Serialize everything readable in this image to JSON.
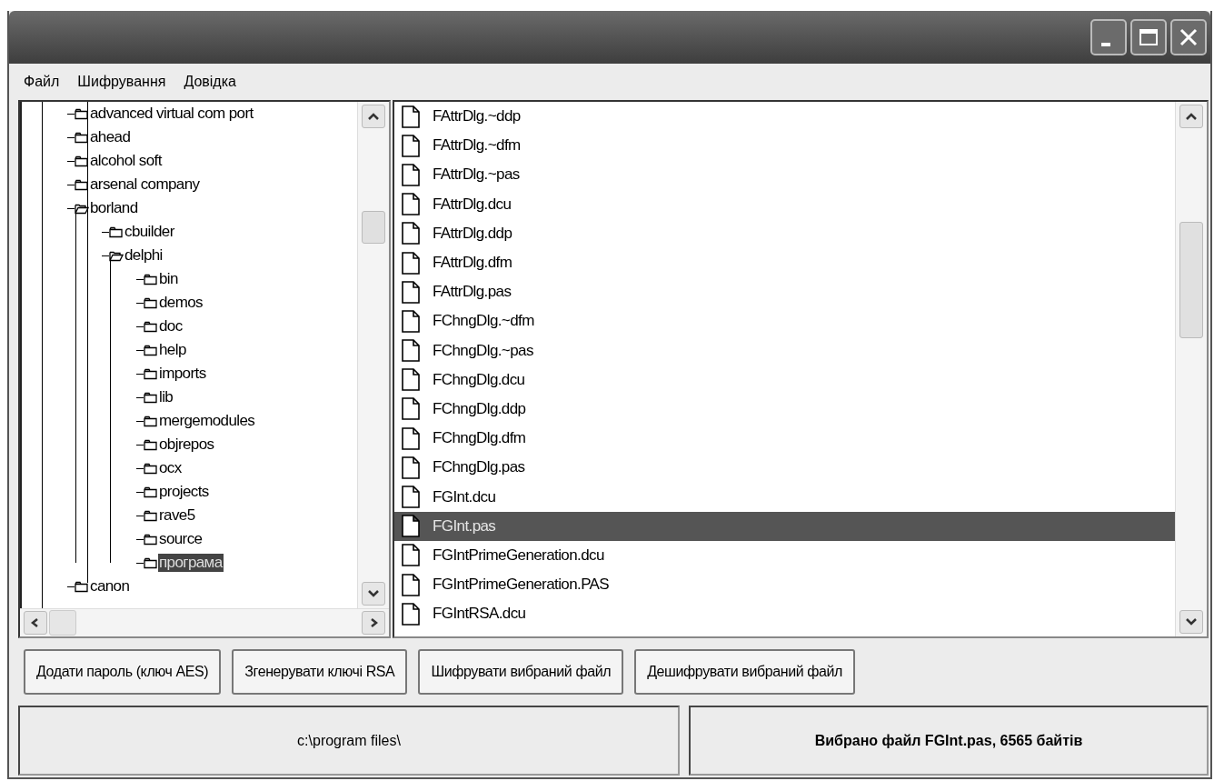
{
  "menu": [
    {
      "label": "Файл"
    },
    {
      "label": "Шифрування"
    },
    {
      "label": "Довідка"
    }
  ],
  "tree": [
    {
      "label": "advanced virtual com port",
      "expanded": false,
      "selected": false
    },
    {
      "label": "ahead",
      "expanded": false,
      "selected": false
    },
    {
      "label": "alcohol soft",
      "expanded": false,
      "selected": false
    },
    {
      "label": "arsenal company",
      "expanded": false,
      "selected": false
    },
    {
      "label": "borland",
      "expanded": true,
      "selected": false,
      "children": [
        {
          "label": "cbuilder",
          "expanded": false,
          "selected": false
        },
        {
          "label": "delphi",
          "expanded": true,
          "selected": false,
          "children": [
            {
              "label": "bin",
              "expanded": false,
              "selected": false
            },
            {
              "label": "demos",
              "expanded": false,
              "selected": false
            },
            {
              "label": "doc",
              "expanded": false,
              "selected": false
            },
            {
              "label": "help",
              "expanded": false,
              "selected": false
            },
            {
              "label": "imports",
              "expanded": false,
              "selected": false
            },
            {
              "label": "lib",
              "expanded": false,
              "selected": false
            },
            {
              "label": "mergemodules",
              "expanded": false,
              "selected": false
            },
            {
              "label": "objrepos",
              "expanded": false,
              "selected": false
            },
            {
              "label": "ocx",
              "expanded": false,
              "selected": false
            },
            {
              "label": "projects",
              "expanded": false,
              "selected": false
            },
            {
              "label": "rave5",
              "expanded": false,
              "selected": false
            },
            {
              "label": "source",
              "expanded": false,
              "selected": false
            },
            {
              "label": "програма",
              "expanded": false,
              "selected": true
            }
          ]
        }
      ]
    },
    {
      "label": "canon",
      "expanded": false,
      "selected": false
    }
  ],
  "files": [
    {
      "name": "FAttrDlg.~ddp",
      "selected": false
    },
    {
      "name": "FAttrDlg.~dfm",
      "selected": false
    },
    {
      "name": "FAttrDlg.~pas",
      "selected": false
    },
    {
      "name": "FAttrDlg.dcu",
      "selected": false
    },
    {
      "name": "FAttrDlg.ddp",
      "selected": false
    },
    {
      "name": "FAttrDlg.dfm",
      "selected": false
    },
    {
      "name": "FAttrDlg.pas",
      "selected": false
    },
    {
      "name": "FChngDlg.~dfm",
      "selected": false
    },
    {
      "name": "FChngDlg.~pas",
      "selected": false
    },
    {
      "name": "FChngDlg.dcu",
      "selected": false
    },
    {
      "name": "FChngDlg.ddp",
      "selected": false
    },
    {
      "name": "FChngDlg.dfm",
      "selected": false
    },
    {
      "name": "FChngDlg.pas",
      "selected": false
    },
    {
      "name": "FGInt.dcu",
      "selected": false
    },
    {
      "name": "FGInt.pas",
      "selected": true
    },
    {
      "name": "FGIntPrimeGeneration.dcu",
      "selected": false
    },
    {
      "name": "FGIntPrimeGeneration.PAS",
      "selected": false
    },
    {
      "name": "FGIntRSA.dcu",
      "selected": false
    }
  ],
  "buttons": [
    {
      "label": "Додати пароль (ключ AES)"
    },
    {
      "label": "Згенерувати ключі RSA"
    },
    {
      "label": "Шифрувати вибраний файл"
    },
    {
      "label": "Дешифрувати вибраний файл"
    }
  ],
  "status_bar": {
    "path": "c:\\program files\\",
    "info": "Вибрано файл FGInt.pas, 6565 байтів"
  }
}
